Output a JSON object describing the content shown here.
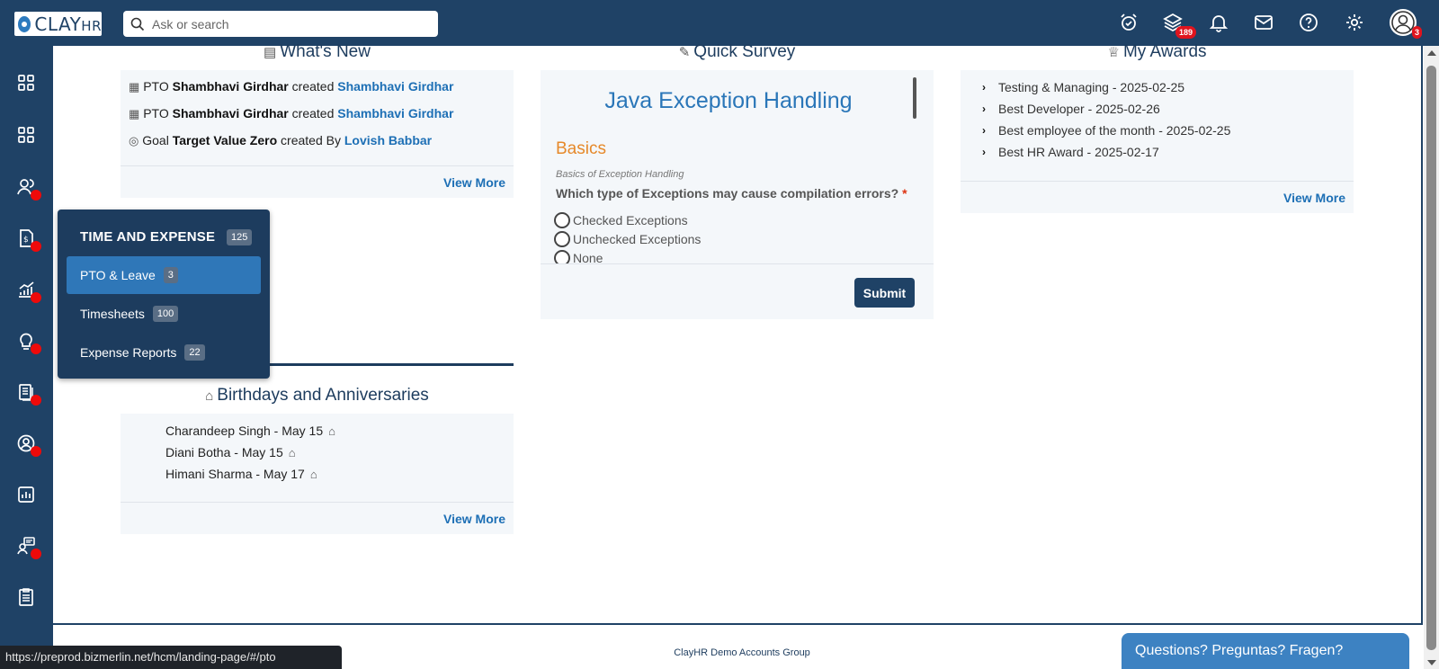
{
  "app": {
    "logo_text": "CLAY",
    "logo_suffix": "HR",
    "search_placeholder": "Ask or search"
  },
  "topbar": {
    "icons": [
      "alarm-icon",
      "layers-icon",
      "bell-icon",
      "mail-icon",
      "help-icon",
      "gear-icon",
      "user-avatar-icon"
    ],
    "layers_badge": "189",
    "avatar_badge": "3"
  },
  "sidebar": {
    "items": [
      "dashboard-icon",
      "apps-icon",
      "people-icon",
      "time-expense-icon",
      "growth-icon",
      "ideas-icon",
      "documents-icon",
      "profile-icon",
      "reports-icon",
      "training-icon",
      "checklist-icon"
    ]
  },
  "whats_new": {
    "title": "What's New",
    "rows": [
      {
        "type": "PTO",
        "actor": "Shambhavi Girdhar",
        "verb": "created",
        "target": "Shambhavi Girdhar"
      },
      {
        "type": "PTO",
        "actor": "Shambhavi Girdhar",
        "verb": "created",
        "target": "Shambhavi Girdhar"
      },
      {
        "type": "Goal",
        "actor": "Target Value Zero",
        "verb": "created By",
        "target": "Lovish Babbar"
      }
    ],
    "view_more": "View More"
  },
  "survey": {
    "title": "Quick Survey",
    "heading": "Java Exception Handling",
    "section": "Basics",
    "description": "Basics of Exception Handling",
    "question": "Which type of Exceptions may cause compilation errors?",
    "required_mark": "*",
    "options": [
      "Checked Exceptions",
      "Unchecked Exceptions",
      "None"
    ],
    "submit": "Submit"
  },
  "awards": {
    "title": "My Awards",
    "items": [
      "Testing & Managing - 2025-02-25",
      "Best Developer - 2025-02-26",
      "Best employee of the month - 2025-02-25",
      "Best HR Award - 2025-02-17"
    ],
    "view_more": "View More"
  },
  "birthdays": {
    "title": "Birthdays and Anniversaries",
    "items": [
      "Charandeep Singh - May 15",
      "Diani Botha - May 15",
      "Himani Sharma - May 17"
    ],
    "view_more": "View More"
  },
  "menu": {
    "title": "TIME AND EXPENSE",
    "title_count": "125",
    "items": [
      {
        "label": "PTO & Leave",
        "count": "3"
      },
      {
        "label": "Timesheets",
        "count": "100"
      },
      {
        "label": "Expense Reports",
        "count": "22"
      }
    ]
  },
  "footer": {
    "group": "ClayHR Demo Accounts Group",
    "status_url": "https://preprod.bizmerlin.net/hcm/landing-page/#/pto",
    "help": "Questions? Preguntas? Fragen?"
  },
  "colors": {
    "brand": "#1f4266",
    "accent": "#2f77b8",
    "link": "#1d6fb5",
    "section": "#e6892a",
    "badge": "#e0141e"
  }
}
